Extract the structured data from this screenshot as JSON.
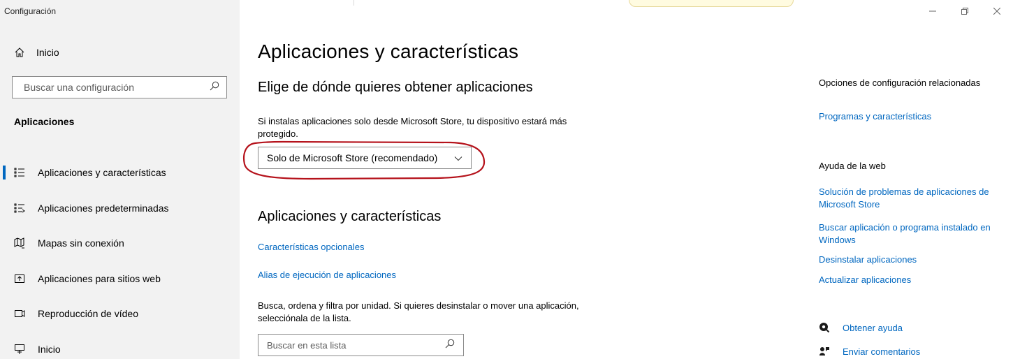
{
  "window": {
    "title": "Configuración",
    "controls": [
      "minimize",
      "restore",
      "close"
    ]
  },
  "sidebar": {
    "home_label": "Inicio",
    "search_placeholder": "Buscar una configuración",
    "section_title": "Aplicaciones",
    "items": [
      {
        "label": "Aplicaciones y características",
        "icon": "apps-features-icon",
        "active": true
      },
      {
        "label": "Aplicaciones predeterminadas",
        "icon": "default-apps-icon",
        "active": false
      },
      {
        "label": "Mapas sin conexión",
        "icon": "offline-maps-icon",
        "active": false
      },
      {
        "label": "Aplicaciones para sitios web",
        "icon": "apps-for-websites-icon",
        "active": false
      },
      {
        "label": "Reproducción de vídeo",
        "icon": "video-playback-icon",
        "active": false
      },
      {
        "label": "Inicio",
        "icon": "startup-icon",
        "active": false
      }
    ]
  },
  "main": {
    "title": "Aplicaciones y características",
    "source_heading": "Elige de dónde quieres obtener aplicaciones",
    "source_description": "Si instalas aplicaciones solo desde Microsoft Store, tu dispositivo estará más protegido.",
    "source_dropdown_value": "Solo de Microsoft Store (recomendado)",
    "apps_heading": "Aplicaciones y características",
    "optional_features_link": "Características opcionales",
    "app_alias_link": "Alias de ejecución de aplicaciones",
    "list_description": "Busca, ordena y filtra por unidad. Si quieres desinstalar o mover una aplicación, selecciónala de la lista.",
    "list_search_placeholder": "Buscar en esta lista"
  },
  "related": {
    "heading": "Opciones de configuración relacionadas",
    "programs_link": "Programas y características",
    "web_help_heading": "Ayuda de la web",
    "links": [
      "Solución de problemas de aplicaciones de Microsoft Store",
      "Buscar aplicación o programa instalado en Windows",
      "Desinstalar aplicaciones",
      "Actualizar aplicaciones"
    ],
    "get_help": "Obtener ayuda",
    "send_feedback": "Enviar comentarios"
  },
  "colors": {
    "accent": "#0067c0",
    "sidebar_bg": "#f2f2f2",
    "highlight_ring": "#b5121b"
  }
}
